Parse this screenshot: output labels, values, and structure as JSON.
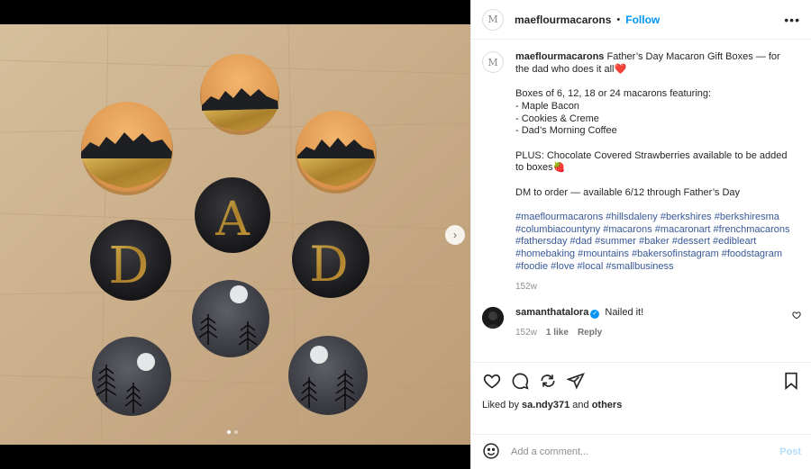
{
  "post": {
    "username": "maeflourmacarons",
    "separator": "•",
    "follow_label": "Follow",
    "more_label": "•••",
    "avatar_letter": "M"
  },
  "caption": {
    "username": "maeflourmacarons",
    "text_lines": [
      "Father’s Day Macaron Gift Boxes — for the dad who does it all❤️",
      "",
      "Boxes of 6, 12, 18 or 24 macarons featuring:\n- Maple Bacon\n- Cookies & Creme\n- Dad’s Morning Coffee",
      "PLUS: Chocolate Covered Strawberries available to be added to boxes🍓",
      "DM to order — available 6/12 through Father’s Day"
    ],
    "hashtags": [
      "#maeflourmacarons",
      "#hillsdaleny",
      "#berkshires",
      "#berkshiresma",
      "#columbiacountyny",
      "#macarons",
      "#macaronart",
      "#frenchmacarons",
      "#fathersday",
      "#dad",
      "#summer",
      "#baker",
      "#dessert",
      "#edibleart",
      "#homebaking",
      "#mountains",
      "#bakersofinstagram",
      "#foodstagram",
      "#foodie",
      "#love",
      "#local",
      "#smallbusiness"
    ],
    "time": "152w"
  },
  "comment": {
    "username": "samanthatalora",
    "verified_mark": "✓",
    "text": "Nailed it!",
    "time": "152w",
    "likes": "1 like",
    "reply_label": "Reply"
  },
  "likes": {
    "prefix": "Liked by ",
    "user": "sa.ndy371",
    "middle": " and ",
    "others": "others"
  },
  "add_comment": {
    "placeholder": "Add a comment...",
    "post_label": "Post"
  },
  "media": {
    "next_glyph": "›",
    "slides": 2,
    "active_slide": 1,
    "letters": [
      "A",
      "D",
      "D"
    ]
  },
  "colors": {
    "follow": "#0095f6",
    "hashtag": "#385898",
    "wood": "#cbb08c",
    "macaron_orange": "#e8a25e",
    "macaron_dark": "#232326",
    "macaron_gray": "#4a4b52",
    "gold": "#c49a3c"
  },
  "icons": [
    "heart-icon",
    "comment-icon",
    "share-icon",
    "send-icon",
    "bookmark-icon",
    "emoji-icon",
    "more-icon",
    "chevron-right-icon",
    "verified-icon"
  ]
}
